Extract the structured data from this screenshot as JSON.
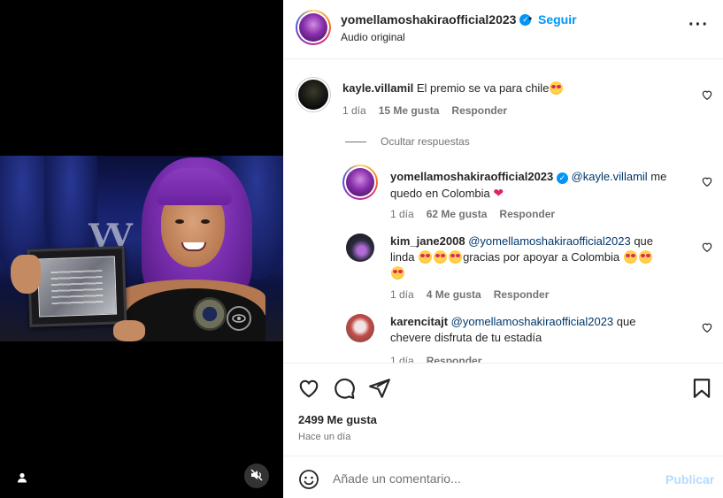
{
  "header": {
    "username": "yomellamoshakiraofficial2023",
    "follow_label": "Seguir",
    "subtitle": "Audio original",
    "separator": "•"
  },
  "comments": [
    {
      "username": "kayle.villamil",
      "text": "El premio se va para chile",
      "time": "1 día",
      "likes": "15 Me gusta",
      "reply": "Responder"
    }
  ],
  "hide_replies_label": "Ocultar respuestas",
  "replies": [
    {
      "username": "yomellamoshakiraofficial2023",
      "mention": "@kayle.villamil",
      "text_line1_rest": " me",
      "text_line2": "quedo en Colombia",
      "time": "1 día",
      "likes": "62 Me gusta",
      "reply": "Responder"
    },
    {
      "username": "kim_jane2008",
      "mention": "@yomellamoshakiraofficial2023",
      "text_line1_rest": " que",
      "text_line2_a": "linda ",
      "text_line2_b": "gracias por apoyar a Colombia ",
      "time": "1 día",
      "likes": "4 Me gusta",
      "reply": "Responder"
    },
    {
      "username": "karencitajt",
      "mention": "@yomellamoshakiraofficial2023",
      "text_line1_rest": " que",
      "text_line2": "chevere disfruta de tu estadía",
      "time": "1 día",
      "reply": "Responder"
    }
  ],
  "stats": {
    "likes": "2499 Me gusta",
    "time_ago": "Hace un día"
  },
  "composer": {
    "placeholder": "Añade un comentario...",
    "publish_label": "Publicar"
  },
  "colors": {
    "accent": "#0095f6",
    "text": "#262626",
    "muted": "#737373",
    "mention": "#00376b",
    "publish_disabled": "#b3dbff"
  }
}
